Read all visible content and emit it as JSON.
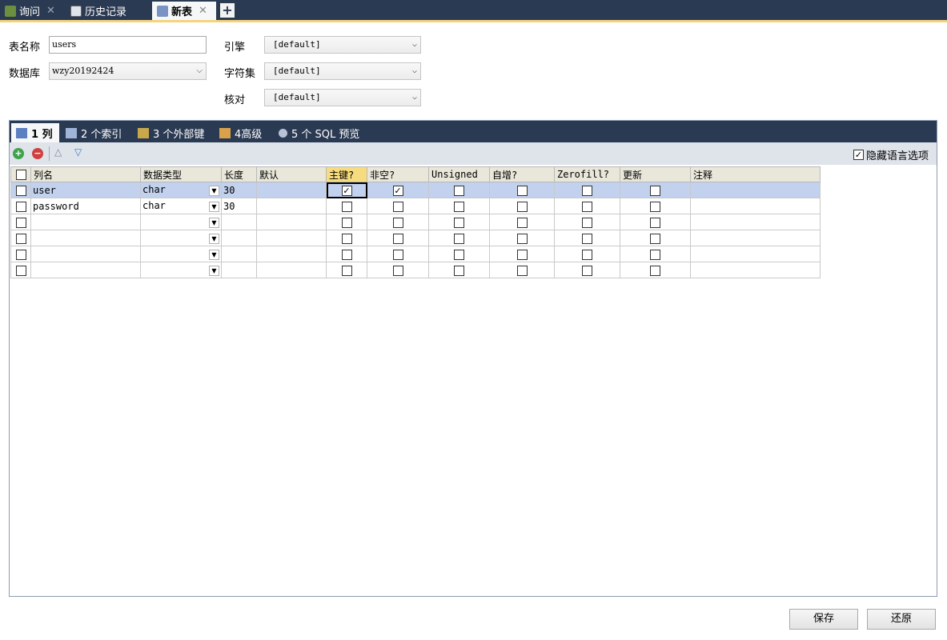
{
  "top_tabs": [
    {
      "label": "询问",
      "icon": "query-icon",
      "active": false
    },
    {
      "label": "历史记录",
      "icon": "history-icon",
      "active": false
    },
    {
      "label": "新表",
      "icon": "new-table-icon",
      "active": true
    }
  ],
  "form": {
    "table_name_label": "表名称",
    "table_name_value": "users",
    "database_label": "数据库",
    "database_value": "wzy20192424",
    "engine_label": "引擎",
    "engine_value": "[default]",
    "charset_label": "字符集",
    "charset_value": "[default]",
    "collation_label": "核对",
    "collation_value": "[default]"
  },
  "inner_tabs": [
    {
      "label": "1 列",
      "active": true
    },
    {
      "label": "2 个索引",
      "active": false
    },
    {
      "label": "3 个外部键",
      "active": false
    },
    {
      "label": "4高级",
      "active": false
    },
    {
      "label": "5 个 SQL 预览",
      "active": false
    }
  ],
  "toolbar": {
    "hide_language_label": "隐藏语言选项",
    "hide_language_checked": true
  },
  "grid": {
    "headers": [
      "列名",
      "数据类型",
      "长度",
      "默认",
      "主键?",
      "非空?",
      "Unsigned",
      "自增?",
      "Zerofill?",
      "更新",
      "注释"
    ],
    "rows": [
      {
        "name": "user",
        "type": "char",
        "length": "30",
        "default": "",
        "pk": true,
        "notnull": true,
        "unsigned": false,
        "autoinc": false,
        "zerofill": false,
        "update": false,
        "comment": "",
        "selected": true
      },
      {
        "name": "password",
        "type": "char",
        "length": "30",
        "default": "",
        "pk": false,
        "notnull": false,
        "unsigned": false,
        "autoinc": false,
        "zerofill": false,
        "update": false,
        "comment": "",
        "selected": false
      },
      {
        "name": "",
        "type": "",
        "length": "",
        "default": "",
        "pk": false,
        "notnull": false,
        "unsigned": false,
        "autoinc": false,
        "zerofill": false,
        "update": false,
        "comment": "",
        "selected": false
      },
      {
        "name": "",
        "type": "",
        "length": "",
        "default": "",
        "pk": false,
        "notnull": false,
        "unsigned": false,
        "autoinc": false,
        "zerofill": false,
        "update": false,
        "comment": "",
        "selected": false
      },
      {
        "name": "",
        "type": "",
        "length": "",
        "default": "",
        "pk": false,
        "notnull": false,
        "unsigned": false,
        "autoinc": false,
        "zerofill": false,
        "update": false,
        "comment": "",
        "selected": false
      },
      {
        "name": "",
        "type": "",
        "length": "",
        "default": "",
        "pk": false,
        "notnull": false,
        "unsigned": false,
        "autoinc": false,
        "zerofill": false,
        "update": false,
        "comment": "",
        "selected": false
      }
    ]
  },
  "buttons": {
    "save": "保存",
    "revert": "还原"
  },
  "colors": {
    "title_bar": "#2b3a53",
    "accent_line": "#f5d37a",
    "selected_row": "#c1d1ee",
    "pk_header": "#f6dc7e"
  }
}
